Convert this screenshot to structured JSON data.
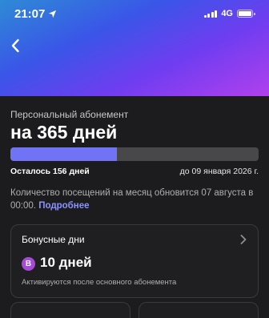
{
  "status_bar": {
    "time": "21:07",
    "network": "4G",
    "signal_level": 4,
    "battery_level": 1.0
  },
  "colors": {
    "accent": "#7073f5",
    "link": "#8a93ff",
    "badge": "#a64bd6",
    "background": "#1c1c1e"
  },
  "header": {
    "back_icon": "chevron-left-icon"
  },
  "subscription": {
    "type_label": "Персональный абонемент",
    "title": "на 365 дней",
    "progress_fraction": 0.428,
    "remaining": "Осталось 156 дней",
    "until": "до 09 января 2026 г.",
    "note": "Количество посещений на месяц обновится 07 августа в 00:00.",
    "more_link": "Подробнее"
  },
  "bonus_card": {
    "title": "Бонусные дни",
    "badge_letter": "В",
    "days": "10 дней",
    "subtitle": "Активируются после основного абонемента",
    "chevron_icon": "chevron-right-icon"
  }
}
